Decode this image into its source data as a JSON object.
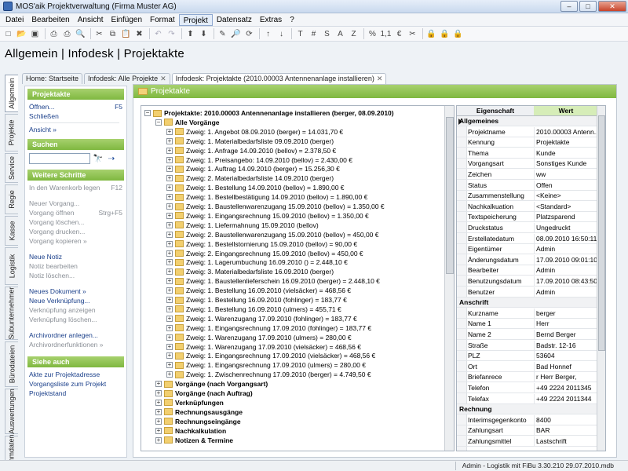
{
  "window": {
    "title": "MOS'aik Projektverwaltung (Firma Muster AG)",
    "min": "–",
    "max": "□",
    "close": "✕"
  },
  "menu": [
    "Datei",
    "Bearbeiten",
    "Ansicht",
    "Einfügen",
    "Format",
    "Projekt",
    "Datensatz",
    "Extras",
    "?"
  ],
  "toolbar": {
    "icons": [
      "new-icon",
      "open-icon",
      "save-icon",
      "print-preview-icon",
      "print-icon",
      "preview-icon",
      "cut-icon",
      "copy-icon",
      "paste-icon",
      "delete-icon",
      "undo-icon",
      "redo-icon",
      "up-icon",
      "down-icon",
      "edit-icon",
      "search-icon",
      "refresh-icon",
      "sort-asc-icon",
      "sort-desc-icon",
      "text-t-icon",
      "hash-icon",
      "s-icon",
      "a-icon",
      "z-icon",
      "percent-icon",
      "number-icon",
      "currency-icon",
      "tools-icon",
      "lock-blue-icon",
      "lock-blue2-icon",
      "lock-red-icon"
    ],
    "glyphs": [
      "□",
      "📂",
      "▣",
      "⎙",
      "⎙",
      "🔍",
      "✂",
      "⧉",
      "📋",
      "✖",
      "↶",
      "↷",
      "⬆",
      "⬇",
      "✎",
      "🔎",
      "⟳",
      "↑",
      "↓",
      "T",
      "#",
      "S",
      "A",
      "Z",
      "%",
      "1,1",
      "€",
      "✂",
      "🔒",
      "🔒",
      "🔒"
    ]
  },
  "page_title": "Allgemein | Infodesk | Projektakte",
  "vtabs": [
    "Allgemein",
    "Projekte",
    "Service",
    "Regie",
    "Kasse",
    "Logistik",
    "Subunternehmer",
    "Bürodateien",
    "Auswertungen",
    "Stammdaten"
  ],
  "tabs": [
    {
      "label": "Home: Startseite",
      "x": ""
    },
    {
      "label": "Infodesk: Alle Projekte",
      "x": "✕"
    },
    {
      "label": "Infodesk: Projektakte (2010.00003 Antennenanlage installieren)",
      "x": "✕"
    }
  ],
  "sidebar": {
    "projektakte": {
      "title": "Projektakte",
      "open": "Öffnen...",
      "open_key": "F5",
      "close": "Schließen",
      "view": "Ansicht »"
    },
    "suchen": {
      "title": "Suchen",
      "binoculars": "🔭",
      "next": "⇢"
    },
    "schritte": {
      "title": "Weitere Schritte",
      "items": [
        {
          "label": "In den Warenkorb legen",
          "key": "F12"
        },
        {
          "label": "Neuer Vorgang...",
          "key": ""
        },
        {
          "label": "Vorgang öffnen",
          "key": "Strg+F5"
        },
        {
          "label": "Vorgang löschen...",
          "key": ""
        },
        {
          "label": "Vorgang drucken...",
          "key": ""
        },
        {
          "label": "Vorgang kopieren »",
          "key": ""
        },
        {
          "label": "Neue Notiz",
          "key": ""
        },
        {
          "label": "Notiz bearbeiten",
          "key": ""
        },
        {
          "label": "Notiz löschen...",
          "key": ""
        },
        {
          "label": "Neues Dokument »",
          "key": ""
        },
        {
          "label": "Neue Verknüpfung...",
          "key": ""
        },
        {
          "label": "Verknüpfung anzeigen",
          "key": ""
        },
        {
          "label": "Verknüpfung löschen...",
          "key": ""
        },
        {
          "label": "Archivordner anlegen...",
          "key": ""
        },
        {
          "label": "Archivordnerfunktionen »",
          "key": ""
        }
      ]
    },
    "siehe": {
      "title": "Siehe auch",
      "items": [
        "Akte zur Projektadresse",
        "Vorgangsliste zum Projekt",
        "Projektstand"
      ]
    }
  },
  "main": {
    "header": "Projektakte",
    "tree_root": "Projektakte: 2010.00003 Antennenanlage installieren (berger, 08.09.2010)",
    "tree_all": "Alle Vorgänge",
    "zweige": [
      "Zweig: 1. Angebot 08.09.2010 (berger) = 14.031,70 €",
      "Zweig: 1. Materialbedarfsliste 09.09.2010 (berger)",
      "Zweig: 1. Anfrage 14.09.2010 (bellov) = 2.378,50 €",
      "Zweig: 1. Preisangebo: 14.09.2010 (bellov) = 2.430,00 €",
      "Zweig: 1. Auftrag 14.09.2010 (berger) = 15.256,30 €",
      "Zweig: 2. Materialbedarfsliste 14.09.2010 (berger)",
      "Zweig: 1. Bestellung 14.09.2010 (bellov) = 1.890,00 €",
      "Zweig: 1. Bestellbestätigung 14.09.2010 (bellov) = 1.890,00 €",
      "Zweig: 1. Baustellenwarenzugang 15.09.2010 (bellov) = 1.350,00 €",
      "Zweig: 1. Eingangsrechnung 15.09.2010 (bellov) = 1.350,00 €",
      "Zweig: 1. Liefermahnung 15.09.2010 (bellov)",
      "Zweig: 2. Baustellenwarenzugang 15.09.2010 (bellov) = 450,00 €",
      "Zweig: 1. Bestellstornierung 15.09.2010 (bellov) = 90,00 €",
      "Zweig: 2. Eingangsrechnung 15.09.2010 (bellov) = 450,00 €",
      "Zweig: 1. Lagerumbuchung 16.09.2010 () = 2.448,10 €",
      "Zweig: 3. Materialbedarfsliste 16.09.2010 (berger)",
      "Zweig: 1. Baustellenlieferschein 16.09.2010 (berger) = 2.448,10 €",
      "Zweig: 1. Bestellung 16.09.2010 (vielsäcker) = 468,56 €",
      "Zweig: 1. Bestellung 16.09.2010 (fohlinger) = 183,77 €",
      "Zweig: 1. Bestellung 16.09.2010 (ulmers) = 455,71 €",
      "Zweig: 1. Warenzugang 17.09.2010 (fohlinger) = 183,77 €",
      "Zweig: 1. Eingangsrechnung 17.09.2010 (fohlinger) = 183,77 €",
      "Zweig: 1. Warenzugang 17.09.2010 (ulmers) = 280,00 €",
      "Zweig: 1. Warenzugang 17.09.2010 (vielsäcker) = 468,56 €",
      "Zweig: 1. Eingangsrechnung 17.09.2010 (vielsäcker) = 468,56 €",
      "Zweig: 1. Eingangsrechnung 17.09.2010 (ulmers) = 280,00 €",
      "Zweig: 1. Zwischenrechnung 17.09.2010 (berger) = 4.749,50 €"
    ],
    "groups": [
      "Vorgänge (nach Vorgangsart)",
      "Vorgänge (nach Auftrag)",
      "Verknüpfungen",
      "Rechnungsausgänge",
      "Rechnungseingänge",
      "Nachkalkulation",
      "Notizen & Termine"
    ],
    "props_header": {
      "key": "Eigenschaft",
      "value": "Wert"
    },
    "props": [
      {
        "k": "Allgemeines",
        "v": "",
        "sec": true
      },
      {
        "k": "Projektname",
        "v": "2010.00003 Antenn..."
      },
      {
        "k": "Kennung",
        "v": "Projektakte"
      },
      {
        "k": "Thema",
        "v": "Kunde"
      },
      {
        "k": "Vorgangsart",
        "v": "Sonstiges Kunde"
      },
      {
        "k": "Zeichen",
        "v": "ww"
      },
      {
        "k": "Status",
        "v": "Offen"
      },
      {
        "k": "Zusammenstellung",
        "v": "<Keine>"
      },
      {
        "k": "Nachkalkuation",
        "v": "<Standard>"
      },
      {
        "k": "Textspeicherung",
        "v": "Platzsparend"
      },
      {
        "k": "Druckstatus",
        "v": "Ungedruckt"
      },
      {
        "k": "Erstellatedatum",
        "v": "08.09.2010 16:50:11"
      },
      {
        "k": "Eigentümer",
        "v": "Admin"
      },
      {
        "k": "Änderungsdatum",
        "v": "17.09.2010 09:01:10"
      },
      {
        "k": "Bearbeiter",
        "v": "Admin"
      },
      {
        "k": "Benutzungsdatum",
        "v": "17.09.2010 08:43:50"
      },
      {
        "k": "Benutzer",
        "v": "Admin"
      },
      {
        "k": "Anschrift",
        "v": "",
        "sec": true
      },
      {
        "k": "Kurzname",
        "v": "berger"
      },
      {
        "k": "Name 1",
        "v": "Herr"
      },
      {
        "k": "Name 2",
        "v": "Bernd Berger"
      },
      {
        "k": "Straße",
        "v": "Badstr. 12-16"
      },
      {
        "k": "PLZ",
        "v": "53604"
      },
      {
        "k": "Ort",
        "v": "Bad Honnef"
      },
      {
        "k": "Briefanrece",
        "v": "r Herr Berger,"
      },
      {
        "k": "Telefon",
        "v": "+49 2224 2011345"
      },
      {
        "k": "Telefax",
        "v": "+49 2224 2011344"
      },
      {
        "k": "Rechnung",
        "v": "",
        "sec": true
      },
      {
        "k": "Interimsgegenkonto",
        "v": "8400"
      },
      {
        "k": "Zahlungsart",
        "v": "BAR"
      },
      {
        "k": "Zahlungsmittel",
        "v": "Lastschrift"
      }
    ]
  },
  "status": {
    "text": "Admin - Logistik mit FiBu 3.30.210 29.07.2010.mdb"
  }
}
